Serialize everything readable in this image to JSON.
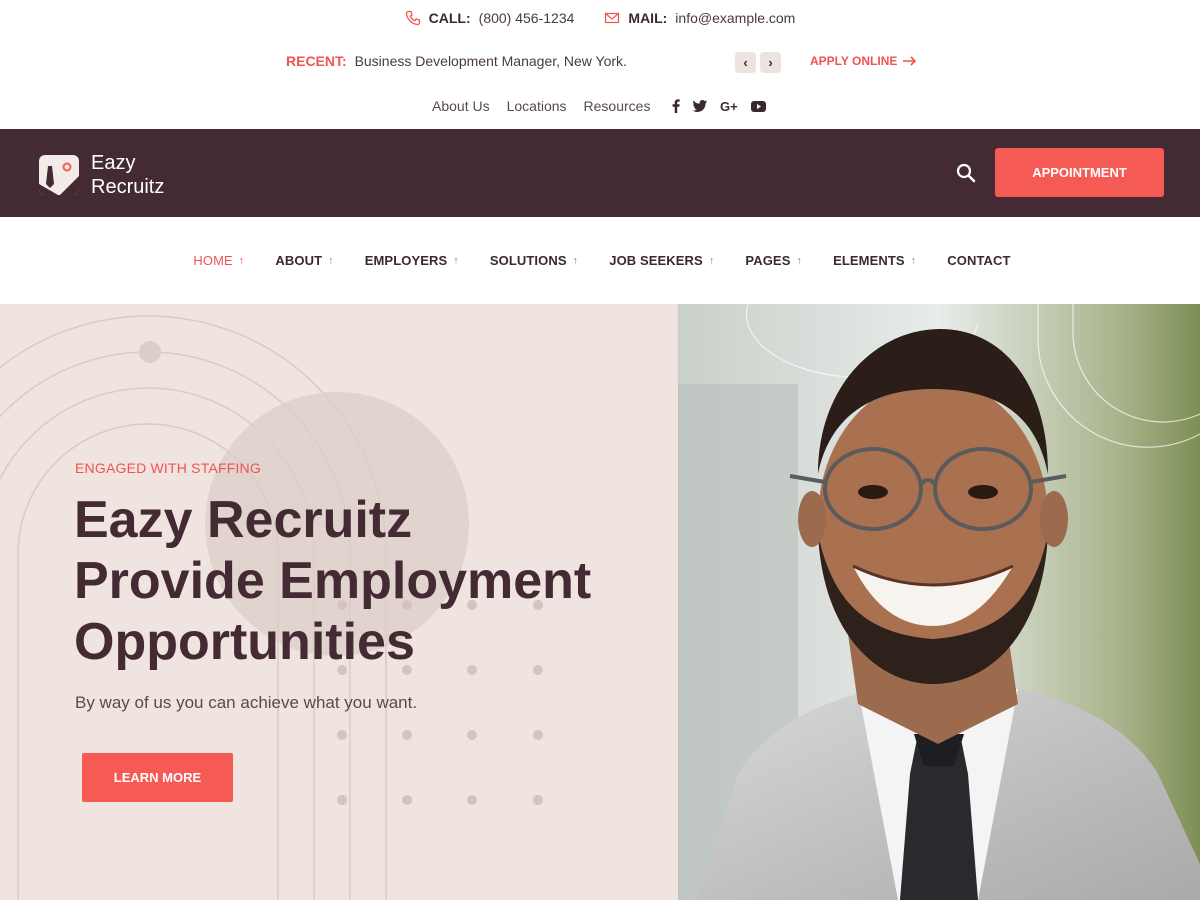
{
  "contact": {
    "call_label": "CALL:",
    "call_value": "(800) 456-1234",
    "mail_label": "MAIL:",
    "mail_value": "info@example.com"
  },
  "recent": {
    "label": "RECENT:",
    "text": "Business Development Manager, New York.",
    "prev_glyph": "‹",
    "next_glyph": "›",
    "apply_label": "APPLY ONLINE"
  },
  "toplinks": [
    "About Us",
    "Locations",
    "Resources"
  ],
  "socials": [
    {
      "icon": "facebook-icon",
      "glyph": "f"
    },
    {
      "icon": "twitter-icon",
      "glyph": "t"
    },
    {
      "icon": "google-plus-icon",
      "glyph": "G+"
    },
    {
      "icon": "youtube-icon",
      "glyph": "▶"
    }
  ],
  "brand": {
    "name_line1": "Eazy",
    "name_line2": "Recruitz",
    "appointment_label": "APPOINTMENT"
  },
  "nav": {
    "items": [
      {
        "label": "HOME",
        "arrow": "↑",
        "active": true
      },
      {
        "label": "ABOUT",
        "arrow": "↑",
        "active": false
      },
      {
        "label": "EMPLOYERS",
        "arrow": "↑",
        "active": false
      },
      {
        "label": "SOLUTIONS",
        "arrow": "↑",
        "active": false
      },
      {
        "label": "JOB SEEKERS",
        "arrow": "↑",
        "active": false
      },
      {
        "label": "PAGES",
        "arrow": "↑",
        "active": false
      },
      {
        "label": "ELEMENTS",
        "arrow": "↑",
        "active": false
      },
      {
        "label": "CONTACT",
        "arrow": "",
        "active": false
      }
    ]
  },
  "hero": {
    "tag": "ENGAGED WITH STAFFING",
    "title_lines": [
      "Eazy Recruitz",
      "Provide Employment",
      "Opportunities"
    ],
    "subtitle": "By way of us you can achieve what you want.",
    "cta_label": "LEARN MORE"
  },
  "colors": {
    "accent": "#f65a55",
    "brand_dark": "#432a33",
    "hero_bg": "#efe4e0"
  }
}
